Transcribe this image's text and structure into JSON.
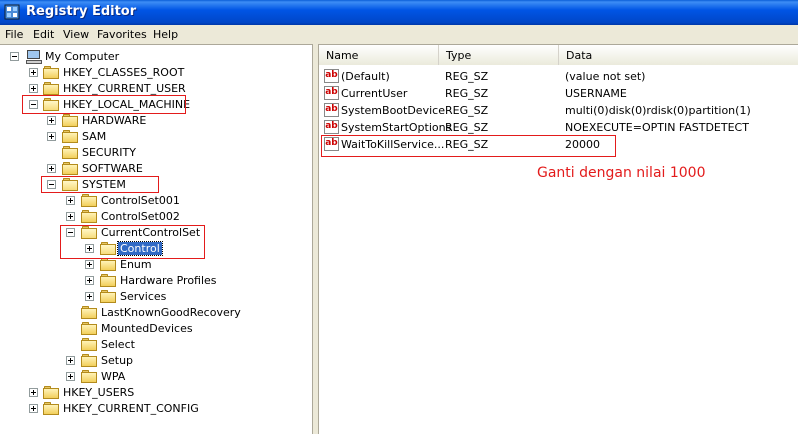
{
  "window": {
    "title": "Registry Editor"
  },
  "menu": [
    "File",
    "Edit",
    "View",
    "Favorites",
    "Help"
  ],
  "tree": {
    "root": "My Computer",
    "hkcr": "HKEY_CLASSES_ROOT",
    "hkcu": "HKEY_CURRENT_USER",
    "hklm": "HKEY_LOCAL_MACHINE",
    "hardware": "HARDWARE",
    "sam": "SAM",
    "security": "SECURITY",
    "software": "SOFTWARE",
    "system": "SYSTEM",
    "cs001": "ControlSet001",
    "cs002": "ControlSet002",
    "ccs": "CurrentControlSet",
    "control": "Control",
    "enum": "Enum",
    "hwprofiles": "Hardware Profiles",
    "services": "Services",
    "lkgr": "LastKnownGoodRecovery",
    "mounted": "MountedDevices",
    "select": "Select",
    "setup": "Setup",
    "wpa": "WPA",
    "hku": "HKEY_USERS",
    "hkcc": "HKEY_CURRENT_CONFIG"
  },
  "list": {
    "columns": {
      "name": "Name",
      "type": "Type",
      "data": "Data"
    },
    "rows": [
      {
        "name": "(Default)",
        "type": "REG_SZ",
        "data": "(value not set)"
      },
      {
        "name": "CurrentUser",
        "type": "REG_SZ",
        "data": "USERNAME"
      },
      {
        "name": "SystemBootDevice",
        "type": "REG_SZ",
        "data": "multi(0)disk(0)rdisk(0)partition(1)"
      },
      {
        "name": "SystemStartOptions",
        "type": "REG_SZ",
        "data": "NOEXECUTE=OPTIN  FASTDETECT"
      },
      {
        "name": "WaitToKillService...",
        "type": "REG_SZ",
        "data": "20000"
      }
    ],
    "value_icon_text": "ab"
  },
  "annotation": "Ganti dengan nilai 1000",
  "colors": {
    "highlight": "#e31b1b",
    "selection": "#316ac5",
    "titlebar": "#0055e5"
  },
  "icons": {
    "folder": "folder-icon",
    "computer": "computer-icon",
    "string_value": "reg-sz-icon"
  }
}
